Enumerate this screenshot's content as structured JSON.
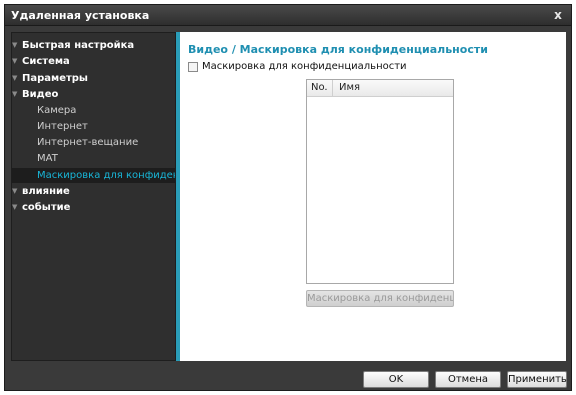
{
  "window": {
    "title": "Удаленная установка",
    "close_label": "x"
  },
  "sidebar": {
    "items": [
      {
        "label": "Быстрая настройка",
        "level": "top"
      },
      {
        "label": "Система",
        "level": "top"
      },
      {
        "label": "Параметры",
        "level": "top"
      },
      {
        "label": "Видео",
        "level": "top"
      },
      {
        "label": "Камера",
        "level": "sub"
      },
      {
        "label": "Интернет",
        "level": "sub"
      },
      {
        "label": "Интернет-вещание",
        "level": "sub"
      },
      {
        "label": "MAT",
        "level": "sub"
      },
      {
        "label": "Маскировка для конфиденциальности",
        "level": "sub",
        "selected": true
      },
      {
        "label": "влияние",
        "level": "top"
      },
      {
        "label": "событие",
        "level": "top"
      }
    ]
  },
  "content": {
    "section_title": "Видео / Маскировка для конфиденциальности",
    "privacy_checkbox_label": "Маскировка для конфиденциальности",
    "list": {
      "columns": [
        "No.",
        "Имя"
      ]
    },
    "privacy_button_label": "Маскировка для конфиденциал..."
  },
  "footer": {
    "ok_label": "OK",
    "cancel_label": "Отмена",
    "apply_label": "Применить"
  },
  "colors": {
    "accent": "#2a9db8",
    "selected_text": "#19b6d8",
    "section_title": "#1f8fb1"
  }
}
